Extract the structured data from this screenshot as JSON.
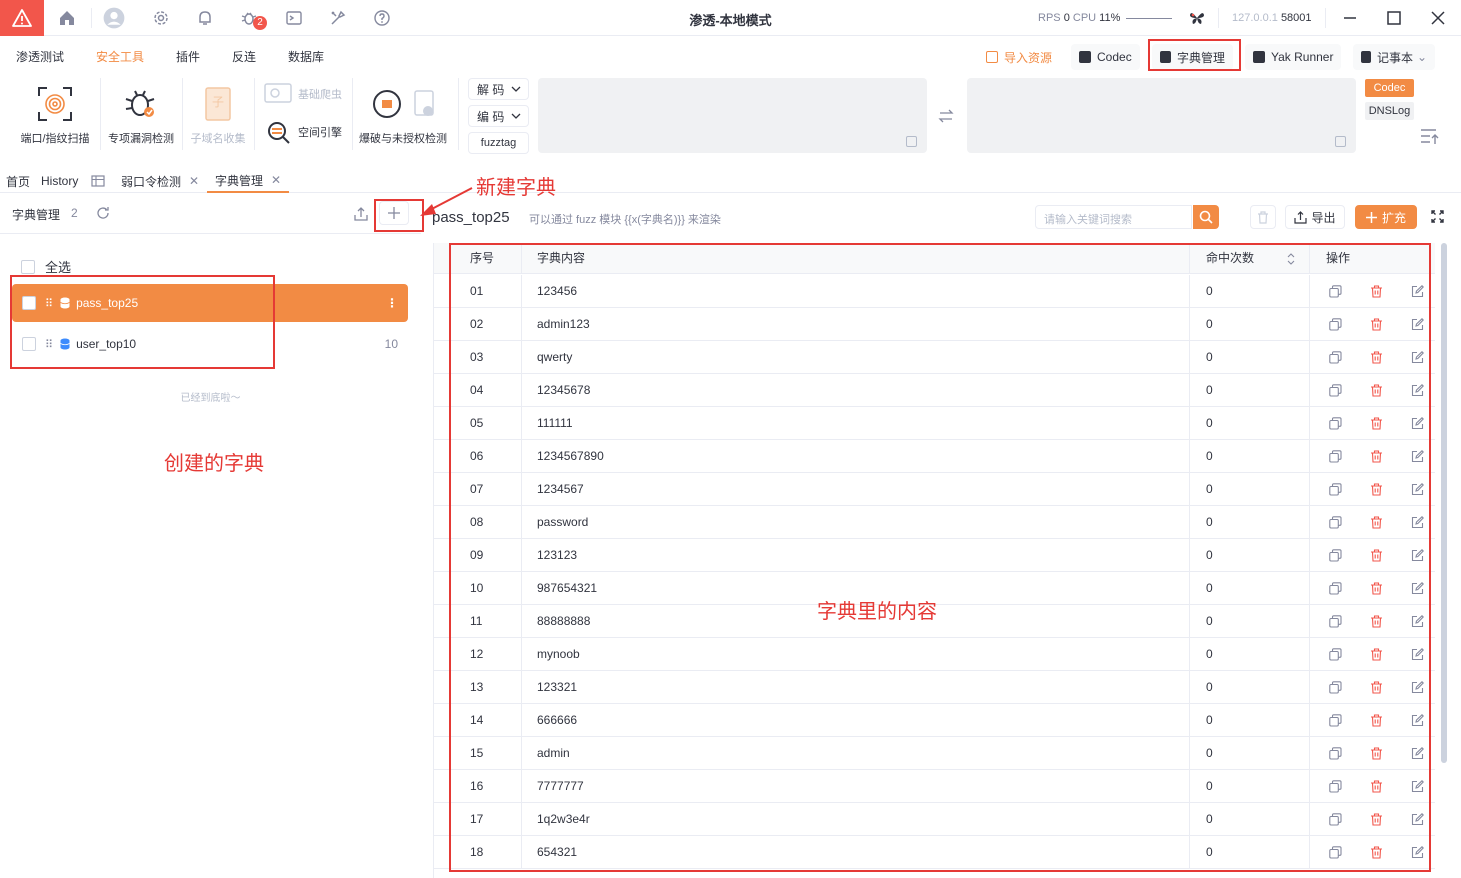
{
  "app": {
    "title": "渗透-本地模式",
    "rps_label": "RPS",
    "rps_value": "0",
    "cpu_label": "CPU",
    "cpu_value": "11%",
    "host": "127.0.0.1",
    "port": "58001",
    "notification_badge": "2",
    "brand_color": "#f28b44",
    "logo_color": "#f2564b"
  },
  "menu": {
    "items": [
      "渗透测试",
      "安全工具",
      "插件",
      "反连",
      "数据库"
    ],
    "active": "安全工具"
  },
  "quick": {
    "import": "导入资源",
    "codec": "Codec",
    "dict": "字典管理",
    "yak_runner": "Yak Runner",
    "notebook": "记事本"
  },
  "tools": {
    "port_scan": "端口/指纹扫描",
    "vuln_check": "专项漏洞检测",
    "subdomain": "子域名收集",
    "crawler": "基础爬虫",
    "space_engine": "空间引擎",
    "brute": "爆破与未授权检测",
    "decode": "解 码",
    "encode": "编 码",
    "fuzztag": "fuzztag"
  },
  "side_tabs": [
    "Codec",
    "DNSLog"
  ],
  "page_tabs": [
    {
      "label": "首页"
    },
    {
      "label": "History"
    },
    {
      "label": "弱口令检测"
    },
    {
      "label": "字典管理"
    }
  ],
  "left": {
    "title": "字典管理",
    "count": "2",
    "select_all": "全选",
    "dicts": [
      {
        "name": "pass_top25"
      },
      {
        "name": "user_top10",
        "count": "10"
      }
    ],
    "end_note": "已经到底啦～"
  },
  "right": {
    "dict_name": "pass_top25",
    "hint": "可以通过 fuzz 模块 {{x(字典名)}} 来渲染",
    "search_placeholder": "请输入关键词搜索",
    "export_label": "导出",
    "expand_label": "扩充",
    "columns": [
      "序号",
      "字典内容",
      "命中次数",
      "操作"
    ],
    "rows": [
      {
        "no": "01",
        "content": "123456",
        "hits": "0"
      },
      {
        "no": "02",
        "content": "admin123",
        "hits": "0"
      },
      {
        "no": "03",
        "content": "qwerty",
        "hits": "0"
      },
      {
        "no": "04",
        "content": "12345678",
        "hits": "0"
      },
      {
        "no": "05",
        "content": "111111",
        "hits": "0"
      },
      {
        "no": "06",
        "content": "1234567890",
        "hits": "0"
      },
      {
        "no": "07",
        "content": "1234567",
        "hits": "0"
      },
      {
        "no": "08",
        "content": "password",
        "hits": "0"
      },
      {
        "no": "09",
        "content": "123123",
        "hits": "0"
      },
      {
        "no": "10",
        "content": "987654321",
        "hits": "0"
      },
      {
        "no": "11",
        "content": "88888888",
        "hits": "0"
      },
      {
        "no": "12",
        "content": "mynoob",
        "hits": "0"
      },
      {
        "no": "13",
        "content": "123321",
        "hits": "0"
      },
      {
        "no": "14",
        "content": "666666",
        "hits": "0"
      },
      {
        "no": "15",
        "content": "admin",
        "hits": "0"
      },
      {
        "no": "16",
        "content": "7777777",
        "hits": "0"
      },
      {
        "no": "17",
        "content": "1q2w3e4r",
        "hits": "0"
      },
      {
        "no": "18",
        "content": "654321",
        "hits": "0"
      }
    ]
  },
  "annotations": {
    "new_dict": "新建字典",
    "created_dicts": "创建的字典",
    "dict_contents": "字典里的内容",
    "color": "#e53935"
  }
}
